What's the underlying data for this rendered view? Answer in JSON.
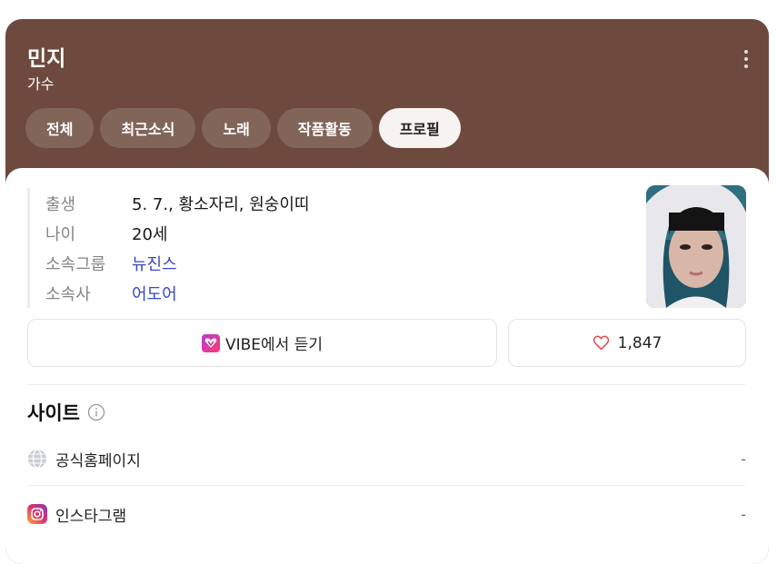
{
  "header": {
    "name": "민지",
    "occupation": "가수",
    "more_icon": "more-vertical-icon"
  },
  "tabs": [
    {
      "label": "전체",
      "active": false
    },
    {
      "label": "최근소식",
      "active": false
    },
    {
      "label": "노래",
      "active": false
    },
    {
      "label": "작품활동",
      "active": false
    },
    {
      "label": "프로필",
      "active": true
    }
  ],
  "profile": {
    "rows": [
      {
        "key": "출생",
        "value": "5. 7., 황소자리, 원숭이띠"
      },
      {
        "key": "나이",
        "value": "20세"
      },
      {
        "key": "소속그룹",
        "value": "뉴진스"
      },
      {
        "key": "소속사",
        "value": "어도어"
      }
    ]
  },
  "actions": {
    "vibe_label": "VIBE에서 듣기",
    "like_count": "1,847"
  },
  "sites": {
    "title": "사이트",
    "items": [
      {
        "label": "공식홈페이지",
        "value": "-",
        "icon": "globe-icon"
      },
      {
        "label": "인스타그램",
        "value": "-",
        "icon": "instagram-icon"
      }
    ]
  },
  "colors": {
    "card_bg": "#6d4a3d",
    "link": "#3a47c2",
    "heart": "#e5484d"
  }
}
